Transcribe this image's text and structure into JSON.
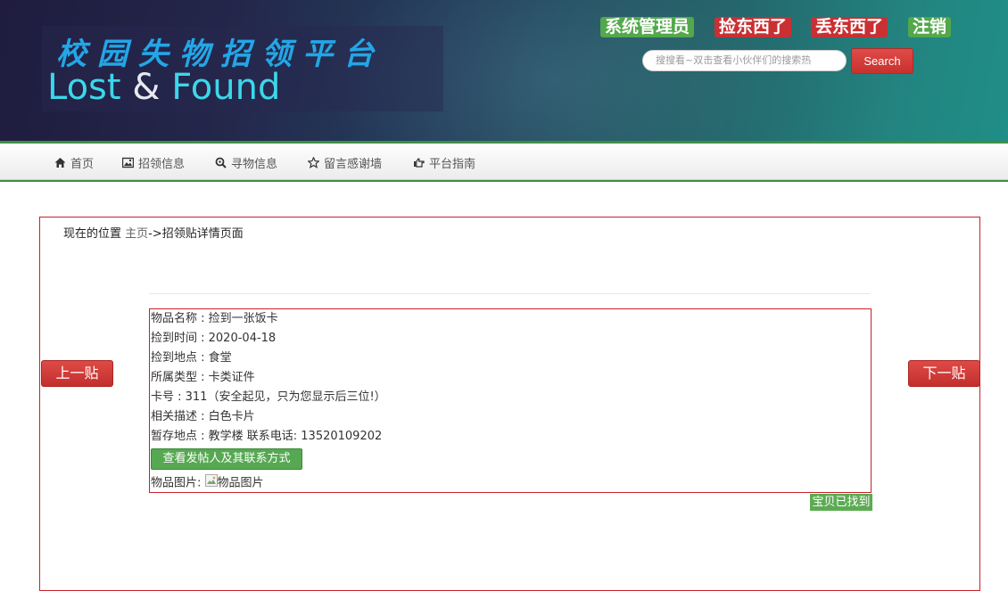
{
  "header": {
    "logo_cn": "校园失物招领平台",
    "logo_en_left": "Lost ",
    "logo_en_amp": "&",
    "logo_en_right": " Found",
    "links": [
      {
        "label": "系统管理员",
        "style": "green"
      },
      {
        "label": "捡东西了",
        "style": "red"
      },
      {
        "label": "丢东西了",
        "style": "red"
      },
      {
        "label": "注销",
        "style": "green"
      }
    ],
    "search_placeholder": "搜搜看~双击查看小伙伴们的搜索热",
    "search_button": "Search"
  },
  "nav": {
    "items": [
      {
        "label": "首页",
        "icon": "home-icon"
      },
      {
        "label": "招领信息",
        "icon": "picture-icon"
      },
      {
        "label": "寻物信息",
        "icon": "zoom-icon"
      },
      {
        "label": "留言感谢墙",
        "icon": "star-icon"
      },
      {
        "label": "平台指南",
        "icon": "hand-point-icon"
      }
    ]
  },
  "main": {
    "breadcrumb_prefix": "现在的位置 ",
    "breadcrumb_home": "主页",
    "breadcrumb_rest": "->招领贴详情页面",
    "prev_label": "上一贴",
    "next_label": "下一贴",
    "details": [
      "物品名称 : 捡到一张饭卡",
      "捡到时间 : 2020-04-18",
      "捡到地点 : 食堂",
      "所属类型 : 卡类证件",
      "卡号 : 311（安全起见，只为您显示后三位!）",
      "相关描述 : 白色卡片",
      "暂存地点 : 教学楼   联系电话: 13520109202"
    ],
    "contact_button": "查看发帖人及其联系方式",
    "image_label": "物品图片:",
    "image_alt": "物品图片",
    "found_tag": "宝贝已找到"
  },
  "colors": {
    "accent_red": "#c93033",
    "accent_green": "#52a84a",
    "frame_red": "#c72228"
  }
}
